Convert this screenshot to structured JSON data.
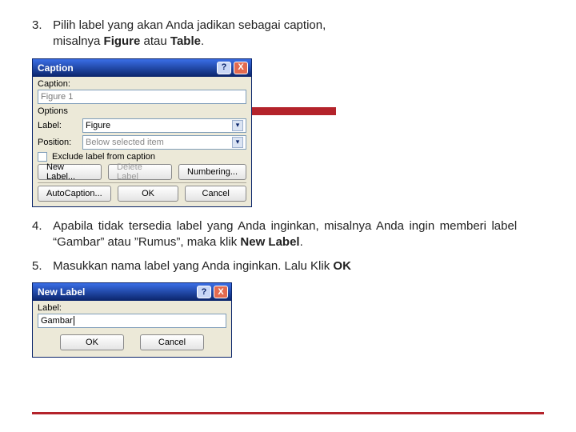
{
  "instructions": {
    "step3": {
      "num": "3.",
      "line1": "Pilih label yang akan Anda jadikan sebagai caption,",
      "line2a": "misalnya ",
      "bold1": "Figure",
      "mid": " atau ",
      "bold2": "Table",
      "end": "."
    },
    "step4": {
      "num": "4.",
      "line": "Apabila tidak tersedia label yang Anda inginkan, misalnya Anda ingin memberi label “Gambar” atau ”Rumus”, maka klik ",
      "bold": "New Label",
      "end": "."
    },
    "step5": {
      "num": "5.",
      "line": "Masukkan nama label yang Anda inginkan. Lalu Klik ",
      "bold": "OK"
    }
  },
  "captionDialog": {
    "title": "Caption",
    "help": "?",
    "close": "X",
    "captionLabel": "Caption:",
    "captionValue": "Figure 1",
    "optionsLabel": "Options",
    "labelLabel": "Label:",
    "labelValue": "Figure",
    "positionLabel": "Position:",
    "positionValue": "Below selected item",
    "excludeLabel": "Exclude label from caption",
    "newLabelBtn": "New Label...",
    "deleteLabelBtn": "Delete Label",
    "numberingBtn": "Numbering...",
    "autoCaptionBtn": "AutoCaption...",
    "okBtn": "OK",
    "cancelBtn": "Cancel"
  },
  "newLabelDialog": {
    "title": "New Label",
    "help": "?",
    "close": "X",
    "labelLabel": "Label:",
    "labelValue": "Gambar",
    "okBtn": "OK",
    "cancelBtn": "Cancel"
  }
}
